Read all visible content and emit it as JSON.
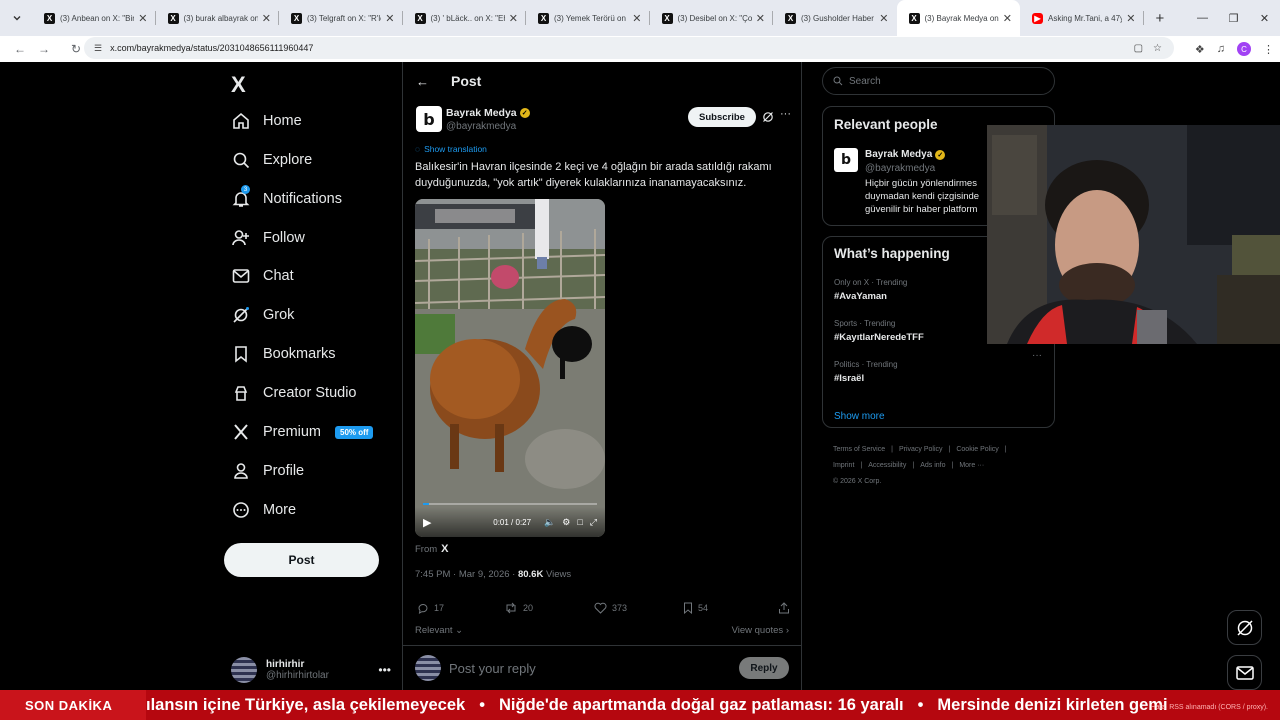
{
  "browser": {
    "tabs": [
      {
        "title": "(3) Anbean on X: \"Bir",
        "favicon": "x-logo"
      },
      {
        "title": "(3) burak albayrak on",
        "favicon": "x-logo"
      },
      {
        "title": "(3) Telgraft on X: \"R'le",
        "favicon": "x-logo"
      },
      {
        "title": "(3) ' bLäck.. on X: \"Eh",
        "favicon": "x-logo"
      },
      {
        "title": "(3) Yemek Terörü on ",
        "favicon": "x-logo"
      },
      {
        "title": "(3) Desibel on X: \"Ço",
        "favicon": "x-logo"
      },
      {
        "title": "(3) Gusholder Haber",
        "favicon": "x-logo"
      },
      {
        "title": "(3) Bayrak Medya on",
        "favicon": "x-logo",
        "active": true
      },
      {
        "title": "Asking Mr.Tani, a 47y",
        "favicon": "youtube"
      }
    ],
    "url": "x.com/bayrakmedya/status/2031048656111960447",
    "profile_initial": "C"
  },
  "sidebar": {
    "logo": "X",
    "items": [
      {
        "label": "Home",
        "icon": "home-icon"
      },
      {
        "label": "Explore",
        "icon": "search-icon"
      },
      {
        "label": "Notifications",
        "icon": "bell-icon",
        "badge": "3"
      },
      {
        "label": "Follow",
        "icon": "person-add-icon"
      },
      {
        "label": "Chat",
        "icon": "mail-icon"
      },
      {
        "label": "Grok",
        "icon": "grok-icon"
      },
      {
        "label": "Bookmarks",
        "icon": "bookmark-icon"
      },
      {
        "label": "Creator Studio",
        "icon": "creator-icon"
      },
      {
        "label": "Premium",
        "icon": "x-icon",
        "promo": "50% off"
      },
      {
        "label": "Profile",
        "icon": "person-icon"
      },
      {
        "label": "More",
        "icon": "more-circle-icon"
      }
    ],
    "post_button": "Post",
    "account": {
      "name": "hirhirhir",
      "handle": "@hirhirhirtolar"
    }
  },
  "post": {
    "header_title": "Post",
    "author_name": "Bayrak Medya",
    "author_handle": "@bayrakmedya",
    "subscribe": "Subscribe",
    "show_translation": "Show translation",
    "text": "Balıkesir'in Havran ilçesinde 2 keçi ve 4 oğlağın bir arada satıldığı rakamı duyduğunuzda, \"yok artık\" diyerek kulaklarınıza inanamayacaksınız.",
    "video_time": "0:01 / 0:27",
    "video_progress": 0.037,
    "from_label": "From",
    "from_source": "X",
    "timestamp": "7:45 PM · Mar 9, 2026 · ",
    "views_count": "80.6K",
    "views_label": " Views",
    "replies": "17",
    "reposts": "20",
    "likes": "373",
    "bookmarks": "54",
    "relevant": "Relevant",
    "view_quotes": "View quotes",
    "reply_placeholder": "Post your reply",
    "reply_button": "Reply"
  },
  "right": {
    "search_placeholder": "Search",
    "relevant_people": {
      "heading": "Relevant people",
      "name": "Bayrak Medya",
      "handle": "@bayrakmedya",
      "bio": [
        "Hiçbir gücün yönlendirmes",
        "duymadan kendi çizgisinde",
        "güvenilir bir haber platform"
      ]
    },
    "happening": {
      "heading": "What’s happening",
      "trends": [
        {
          "context": "Only on X · Trending",
          "tag": "#AvaYaman"
        },
        {
          "context": "Sports · Trending",
          "tag": "#KayıtlarNeredeTFF"
        },
        {
          "context": "Politics · Trending",
          "tag": "#Israël"
        }
      ],
      "show_more": "Show more"
    },
    "footer": [
      "Terms of Service",
      "|",
      "Privacy Policy",
      "|",
      "Cookie Policy",
      "|",
      "Imprint",
      "|",
      "Accessibility",
      "|",
      "Ads info",
      "|",
      "More ···",
      "© 2026 X Corp."
    ]
  },
  "ticker": {
    "label": "SON DAKİKA",
    "items": [
      "ılansın içine Türkiye, asla çekilemeyecek",
      "•",
      "Niğde'de apartmanda doğal gaz patlaması: 16 yaralı",
      "•",
      "Mersinde denizi kirleten gemi"
    ],
    "rss_status": "Hata: RSS alınamadı (CORS / proxy)."
  }
}
